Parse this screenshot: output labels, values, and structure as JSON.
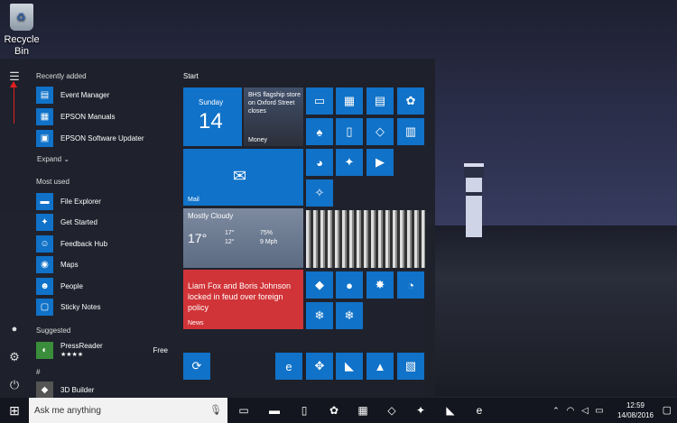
{
  "desktop": {
    "recycle_bin_label": "Recycle Bin"
  },
  "start_menu": {
    "recently_added_header": "Recently added",
    "recently_added": [
      "Event Manager",
      "EPSON Manuals",
      "EPSON Software Updater"
    ],
    "expand_label": "Expand",
    "most_used_header": "Most used",
    "most_used": [
      "File Explorer",
      "Get Started",
      "Feedback Hub",
      "Maps",
      "People",
      "Sticky Notes"
    ],
    "suggested_header": "Suggested",
    "suggested_app": {
      "name": "PressReader",
      "price": "Free",
      "rating": "★★★★"
    },
    "section_hash": "#",
    "section_app": "3D Builder",
    "tiles_header": "Start"
  },
  "tiles": {
    "calendar": {
      "day": "Sunday",
      "date": "14"
    },
    "money": {
      "headline": "BHS flagship store on Oxford Street closes",
      "label": "Money"
    },
    "mail": {
      "label": "Mail"
    },
    "weather": {
      "condition": "Mostly Cloudy",
      "temp": "17°",
      "high": "17°",
      "low": "12°",
      "humidity": "75%",
      "wind": "9 Mph"
    },
    "news": {
      "headline": "Liam Fox and Boris Johnson locked in feud over foreign policy",
      "label": "News"
    }
  },
  "taskbar": {
    "search_placeholder": "Ask me anything",
    "time": "12:59",
    "date": "14/08/2016"
  },
  "colors": {
    "accent": "#1072c8",
    "news_red": "#d13438",
    "arrow_red": "#e02020"
  }
}
